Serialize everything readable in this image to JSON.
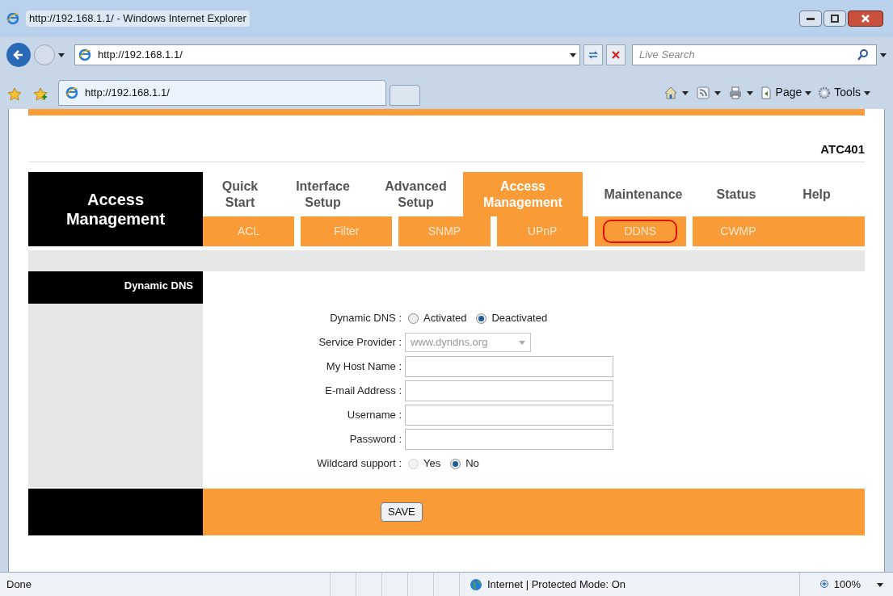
{
  "window": {
    "title": "http://192.168.1.1/ - Windows Internet Explorer"
  },
  "address_bar": {
    "url": "http://192.168.1.1/",
    "search_placeholder": "Live Search"
  },
  "tab": {
    "title": "http://192.168.1.1/"
  },
  "command_bar": [
    {
      "kind": "home"
    },
    {
      "kind": "feeds"
    },
    {
      "kind": "print"
    },
    {
      "kind": "page",
      "label": "Page"
    },
    {
      "kind": "tools",
      "label": "Tools"
    }
  ],
  "router": {
    "model": "ATC401",
    "section_title": "Access Management",
    "main_tabs": [
      {
        "label": "Quick Start",
        "selected": false
      },
      {
        "label": "Interface Setup",
        "selected": false
      },
      {
        "label": "Advanced Setup",
        "selected": false
      },
      {
        "label": "Access Management",
        "selected": true
      },
      {
        "label": "Maintenance",
        "selected": false
      },
      {
        "label": "Status",
        "selected": false
      },
      {
        "label": "Help",
        "selected": false
      }
    ],
    "sub_tabs": [
      {
        "label": "ACL",
        "circled": false
      },
      {
        "label": "Filter",
        "circled": false
      },
      {
        "label": "SNMP",
        "circled": false
      },
      {
        "label": "UPnP",
        "circled": false
      },
      {
        "label": "DDNS",
        "circled": true
      },
      {
        "label": "CWMP",
        "circled": false
      }
    ],
    "sidebar_title": "Dynamic DNS",
    "form": [
      {
        "kind": "radio",
        "label": "Dynamic DNS :",
        "options": [
          {
            "label": "Activated",
            "selected": false,
            "disabled": false
          },
          {
            "label": "Deactivated",
            "selected": true,
            "disabled": false
          }
        ]
      },
      {
        "kind": "select",
        "label": "Service Provider :",
        "value": "www.dyndns.org",
        "disabled": true
      },
      {
        "kind": "text",
        "label": "My Host Name :"
      },
      {
        "kind": "text",
        "label": "E-mail Address :"
      },
      {
        "kind": "text",
        "label": "Username :"
      },
      {
        "kind": "text",
        "label": "Password :"
      },
      {
        "kind": "radio",
        "label": "Wildcard support :",
        "options": [
          {
            "label": "Yes",
            "selected": false,
            "disabled": true
          },
          {
            "label": "No",
            "selected": true,
            "disabled": false
          }
        ]
      }
    ],
    "save_button": "SAVE"
  },
  "status_bar": {
    "text": "Done",
    "zone": "Internet | Protected Mode: On",
    "zoom": "100%"
  }
}
